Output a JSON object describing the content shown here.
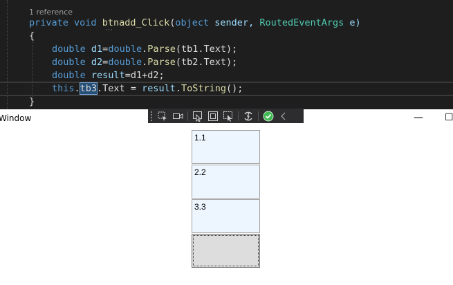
{
  "editor": {
    "reference_text": "1 reference",
    "line_signature": {
      "kw1": "private",
      "kw2": "void",
      "method": "btnadd_Click",
      "p1": "(",
      "kw3": "object",
      "arg1": " sender, ",
      "type": "RoutedEventArgs",
      "arg2": " e)"
    },
    "line_open": "{",
    "line_d1": {
      "kw": "double",
      "var": " d1",
      "eq": "=",
      "type": "double",
      "dot": ".",
      "fn": "Parse",
      "rest": "(tb1.Text);"
    },
    "line_d2": {
      "kw": "double",
      "var": " d2",
      "eq": "=",
      "type": "double",
      "dot": ".",
      "fn": "Parse",
      "rest": "(tb2.Text);"
    },
    "line_result": {
      "kw": "double",
      "var": " result",
      "rest": "=d1+d2;"
    },
    "line_assign": {
      "kw": "this",
      "dot": ".",
      "sel": "tb3",
      "mid": ".Text = ",
      "var": "result",
      "dot2": ".",
      "fn": "ToString",
      "end": "();"
    },
    "line_close": "}"
  },
  "window": {
    "title": "Window",
    "minimize": "—",
    "maximize": "☐"
  },
  "textboxes": [
    {
      "value": "1.1"
    },
    {
      "value": "2.2"
    },
    {
      "value": "3.3"
    }
  ],
  "add_button": {
    "label": ""
  },
  "icons": [
    "select-element-icon",
    "video-icon",
    "pointer-icon",
    "layout-adorner-icon",
    "track-focus-icon",
    "hot-reload-icon",
    "check-icon",
    "chevron-left-icon"
  ]
}
